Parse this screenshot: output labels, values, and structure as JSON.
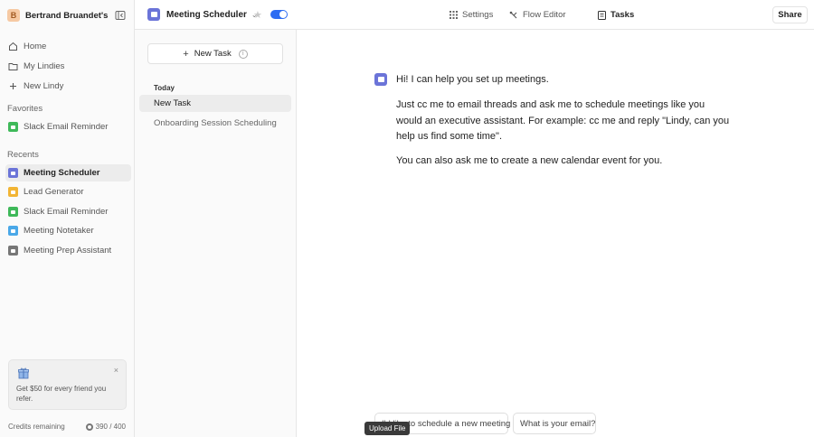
{
  "workspace": {
    "initial": "B",
    "name": "Bertrand Bruandet's..."
  },
  "nav": [
    {
      "label": "Home",
      "icon": "home-icon"
    },
    {
      "label": "My Lindies",
      "icon": "folder-icon"
    },
    {
      "label": "New Lindy",
      "icon": "plus-icon"
    }
  ],
  "favorites": {
    "label": "Favorites",
    "items": [
      {
        "label": "Slack Email Reminder",
        "color": "#3fb95a"
      }
    ]
  },
  "recents": {
    "label": "Recents",
    "items": [
      {
        "label": "Meeting Scheduler",
        "color": "#6b74d8"
      },
      {
        "label": "Lead Generator",
        "color": "#f2b535"
      },
      {
        "label": "Slack Email Reminder",
        "color": "#3fb95a"
      },
      {
        "label": "Meeting Notetaker",
        "color": "#4aa8e8"
      },
      {
        "label": "Meeting Prep Assistant",
        "color": "#777777"
      }
    ]
  },
  "promo": {
    "text": "Get $50 for every friend you refer.",
    "close": "×"
  },
  "credits": {
    "label": "Credits remaining",
    "value": "390 / 400"
  },
  "header": {
    "app_name": "Meeting Scheduler",
    "tabs": [
      {
        "label": "Settings",
        "icon": "grid-icon"
      },
      {
        "label": "Flow Editor",
        "icon": "flow-icon"
      },
      {
        "label": "Tasks",
        "icon": "document-icon"
      }
    ],
    "share": "Share"
  },
  "tasks": {
    "new_task": "New Task",
    "group": "Today",
    "items": [
      "New Task",
      "Onboarding Session Scheduling"
    ]
  },
  "chat": {
    "messages": [
      "Hi! I can help you set up meetings.",
      "Just cc me to email threads and ask me to schedule meetings like you would an executive assistant. For example: cc me and reply \"Lindy, can you help us find some time\".",
      "You can also ask me to create a new calendar event for you."
    ],
    "suggestions": [
      "I'd like to schedule a new meeting",
      "What is your email?"
    ],
    "tooltip": "Upload File"
  }
}
